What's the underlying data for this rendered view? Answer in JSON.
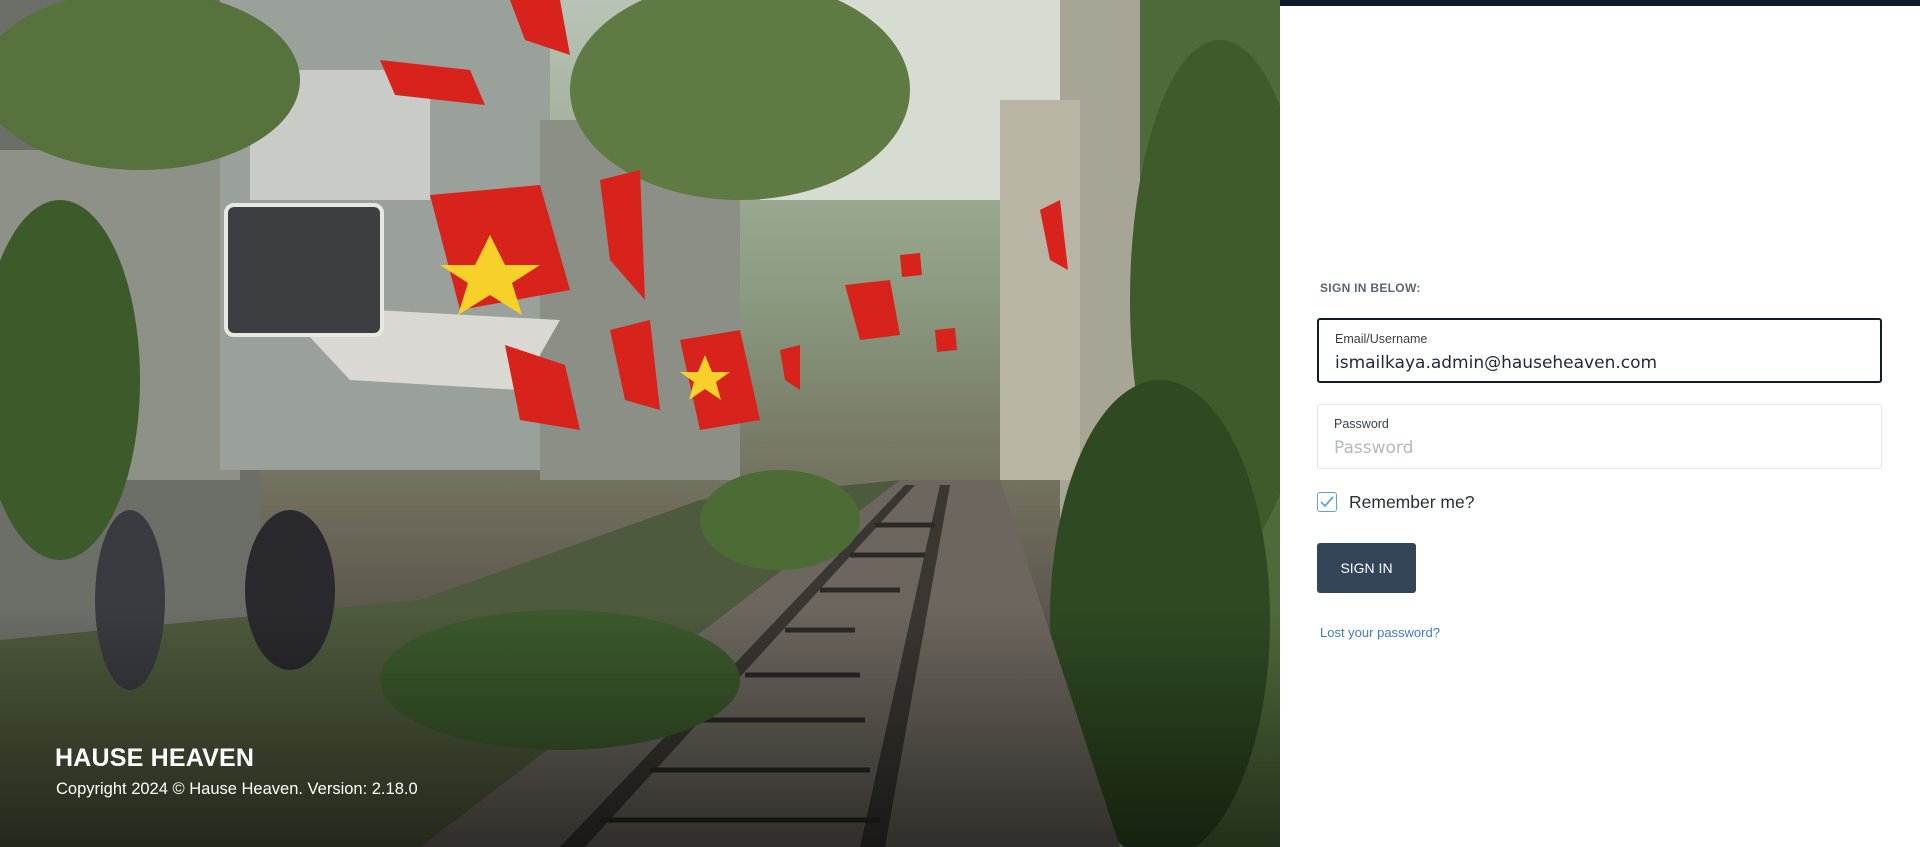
{
  "hero": {
    "image_icon": "street-photo-image",
    "brand_name": "HAUSE HEAVEN",
    "copyright": "Copyright 2024 © Hause Heaven. Version: 2.18.0"
  },
  "login": {
    "heading": "SIGN IN BELOW:",
    "email": {
      "label": "Email/Username",
      "value": "ismailkaya.admin@hauseheaven.com",
      "placeholder": "Email/Username"
    },
    "password": {
      "label": "Password",
      "value": "",
      "placeholder": "Password"
    },
    "remember": {
      "label": "Remember me?",
      "checked": true
    },
    "submit_label": "SIGN IN",
    "lost_password_label": "Lost your password?"
  },
  "colors": {
    "topbar": "#0e1a2b",
    "button": "#34455a",
    "link": "#3f7cc0",
    "checkbox": "#5aa6d6"
  }
}
